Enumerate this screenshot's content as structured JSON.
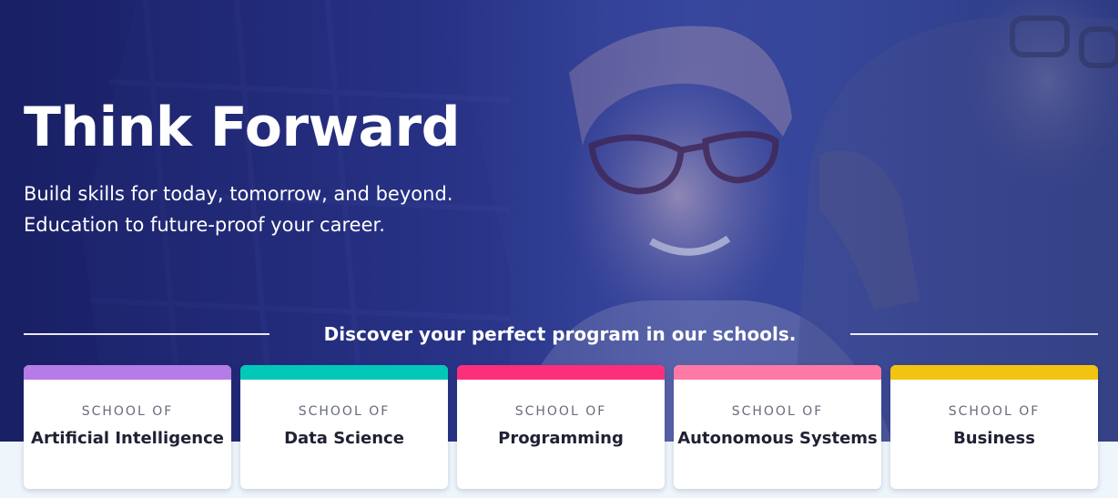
{
  "hero": {
    "title": "Think Forward",
    "subtitle_line1": "Build skills for today, tomorrow, and beyond.",
    "subtitle_line2": "Education to future-proof your career.",
    "discover": "Discover your perfect program in our schools."
  },
  "schools": [
    {
      "kicker": "SCHOOL OF",
      "name": "Artificial Intelligence",
      "color": "#b57be6"
    },
    {
      "kicker": "SCHOOL OF",
      "name": "Data Science",
      "color": "#02c8b9"
    },
    {
      "kicker": "SCHOOL OF",
      "name": "Programming",
      "color": "#fd2e7a"
    },
    {
      "kicker": "SCHOOL OF",
      "name": "Autonomous Systems",
      "color": "#ff79a6"
    },
    {
      "kicker": "SCHOOL OF",
      "name": "Business",
      "color": "#f2c40f"
    }
  ],
  "colors": {
    "hero_overlay": "#27327e",
    "page_background": "#eef5fb",
    "card_text": "#1f2133",
    "card_kicker": "#676b7c"
  }
}
